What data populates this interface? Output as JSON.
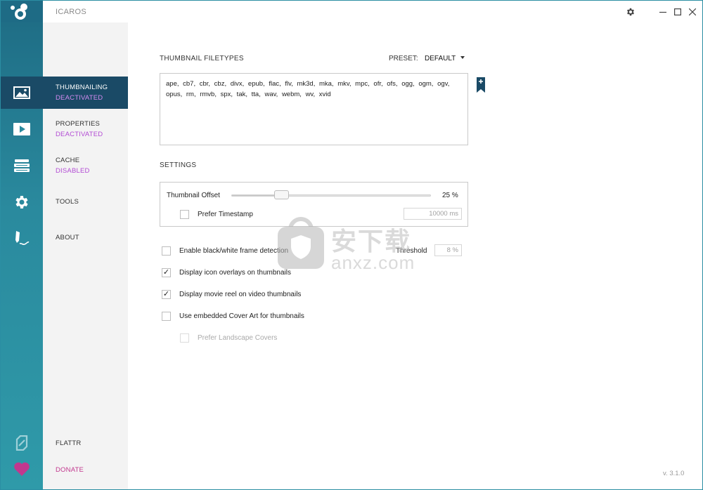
{
  "window": {
    "title": "ICAROS"
  },
  "titlebar": {
    "settings_icon": "gear-icon",
    "minimize_icon": "minimize-icon",
    "maximize_icon": "maximize-icon",
    "close_icon": "close-icon"
  },
  "rail": {
    "items": [
      {
        "icon": "image-icon"
      },
      {
        "icon": "play-icon"
      },
      {
        "icon": "layers-icon"
      },
      {
        "icon": "gear-icon"
      },
      {
        "icon": "pen-icon"
      }
    ],
    "bottom": [
      {
        "icon": "flattr-icon"
      },
      {
        "icon": "heart-icon"
      }
    ]
  },
  "nav": {
    "items": [
      {
        "label": "THUMBNAILING",
        "status": "DEACTIVATED"
      },
      {
        "label": "PROPERTIES",
        "status": "DEACTIVATED"
      },
      {
        "label": "CACHE",
        "status": "DISABLED"
      },
      {
        "label": "TOOLS"
      },
      {
        "label": "ABOUT"
      }
    ],
    "flattr": "FLATTR",
    "donate": "DONATE"
  },
  "filetypes": {
    "title": "THUMBNAIL FILETYPES",
    "preset_label": "PRESET:",
    "preset_value": "DEFAULT",
    "list": "ape, cb7, cbr, cbz, divx, epub, flac, flv, mk3d, mka, mkv, mpc, ofr, ofs, ogg, ogm, ogv, opus, rm, rmvb, spx, tak, tta, wav, webm, wv, xvid"
  },
  "settings": {
    "title": "SETTINGS",
    "thumbnail_offset_label": "Thumbnail Offset",
    "thumbnail_offset_value": "25 %",
    "thumbnail_offset_fraction": 0.25,
    "prefer_timestamp_label": "Prefer Timestamp",
    "prefer_timestamp_checked": false,
    "timestamp_value": "10000 ms",
    "bw_detection_label": "Enable black/white frame detection",
    "bw_detection_checked": false,
    "threshold_label": "Threshold",
    "threshold_value": "8 %",
    "icon_overlays_label": "Display icon overlays on thumbnails",
    "icon_overlays_checked": true,
    "movie_reel_label": "Display movie reel on video thumbnails",
    "movie_reel_checked": true,
    "cover_art_label": "Use embedded Cover Art for thumbnails",
    "cover_art_checked": false,
    "landscape_covers_label": "Prefer Landscape Covers",
    "landscape_covers_checked": false,
    "check_mark": "✓"
  },
  "watermark": {
    "big": "安下载",
    "small": "anxz.com"
  },
  "version": "v. 3.1.0",
  "colors": {
    "rail_top": "#1f6e86",
    "rail_bottom": "#2f9aa9",
    "active_nav": "#1a4a66",
    "status_purple": "#b24bd4",
    "donate_pink": "#c2378e"
  }
}
